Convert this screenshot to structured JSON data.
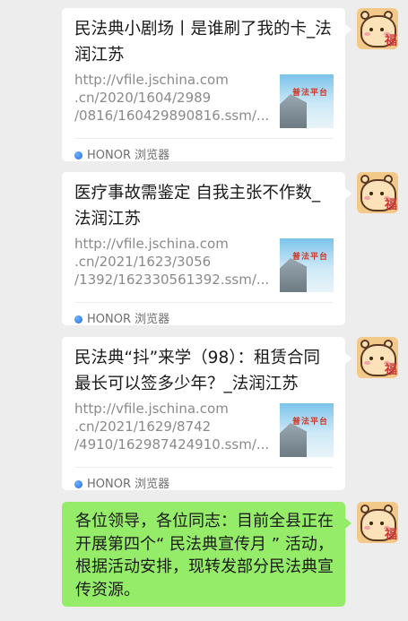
{
  "messages": [
    {
      "type": "link_card",
      "title": "民法典小剧场丨是谁刷了我的卡_法润江苏",
      "url": "http://vfile.jschina.com\n.cn/2020/1604/2989\n/0816/160429890816.ssm/...",
      "thumb_caption": "普法平台",
      "source": "HONOR 浏览器"
    },
    {
      "type": "link_card",
      "title": "医疗事故需鉴定 自我主张不作数_法润江苏",
      "url": "http://vfile.jschina.com\n.cn/2021/1623/3056\n/1392/162330561392.ssm/...",
      "thumb_caption": "普法平台",
      "source": "HONOR 浏览器"
    },
    {
      "type": "link_card",
      "title": "民法典“抖”来学（98）：租赁合同最长可以签多少年？_法润江苏",
      "url": "http://vfile.jschina.com\n.cn/2021/1629/8742\n/4910/162987424910.ssm/...",
      "thumb_caption": "普法平台",
      "source": "HONOR 浏览器"
    },
    {
      "type": "text",
      "text": "各位领导，各位同志：目前全县正在开展第四个“ 民法典宣传月 ” 活动，根据活动安排，现转发部分民法典宣传资源。"
    }
  ],
  "avatar_glyph": "福",
  "colors": {
    "background": "#ededed",
    "card": "#ffffff",
    "sent_bubble": "#95ec69",
    "source_dot": "#2466e0"
  }
}
